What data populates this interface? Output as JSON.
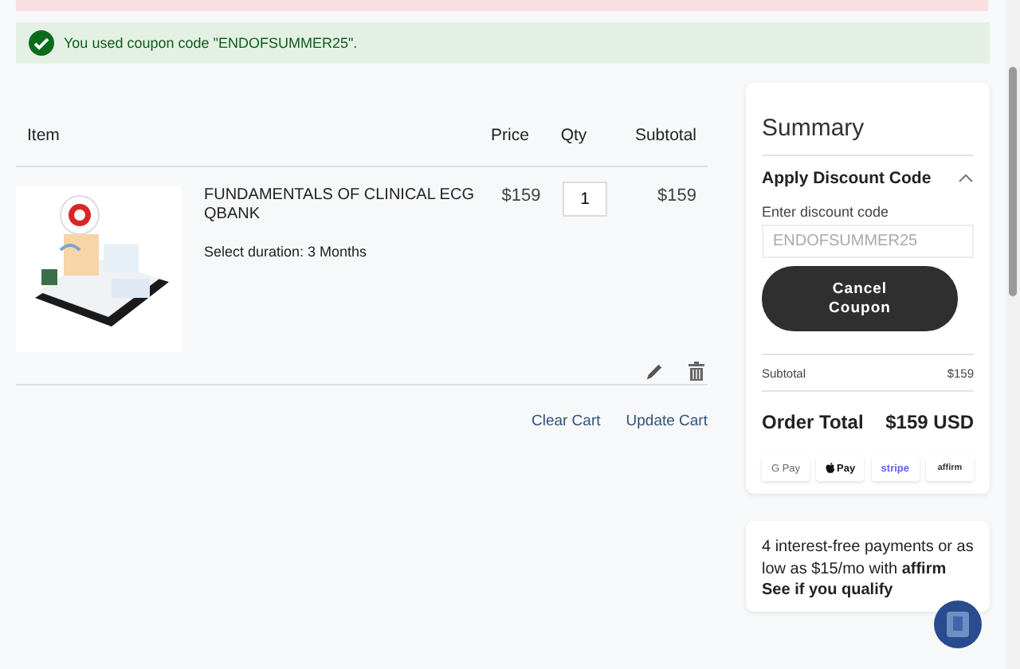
{
  "alerts": [
    {
      "kind": "error"
    },
    {
      "kind": "success",
      "message": "You used coupon code \"ENDOFSUMMER25\"."
    }
  ],
  "cart": {
    "columns": [
      "Item",
      "Price",
      "Qty",
      "Subtotal"
    ],
    "items": [
      {
        "name": "FUNDAMENTALS OF CLINICAL ECG QBANK",
        "option": "Select duration: 3 Months",
        "price": "$159",
        "qty": "1",
        "subtotal": "$159"
      }
    ],
    "actions": [
      "Clear Cart",
      "Update Cart"
    ]
  },
  "summary": {
    "title": "Summary",
    "discount": {
      "heading": "Apply Discount Code",
      "expanded": true,
      "label": "Enter discount code",
      "placeholder": "ENDOFSUMMER25",
      "button": "Cancel Coupon"
    },
    "subtotal": {
      "label": "Subtotal",
      "value": "$159"
    },
    "total": {
      "label": "Order Total",
      "value": "$159 USD"
    },
    "payment_methods": [
      {
        "kind": "gpay",
        "label": "G Pay"
      },
      {
        "kind": "applepay",
        "label": "Pay"
      },
      {
        "kind": "stripe",
        "label": "stripe"
      },
      {
        "kind": "affirm",
        "label": "affirm"
      }
    ]
  },
  "affirm_promo": {
    "text": "4 interest-free payments or as low as $15/mo with",
    "brand": "affirm",
    "link": "See if you qualify"
  }
}
